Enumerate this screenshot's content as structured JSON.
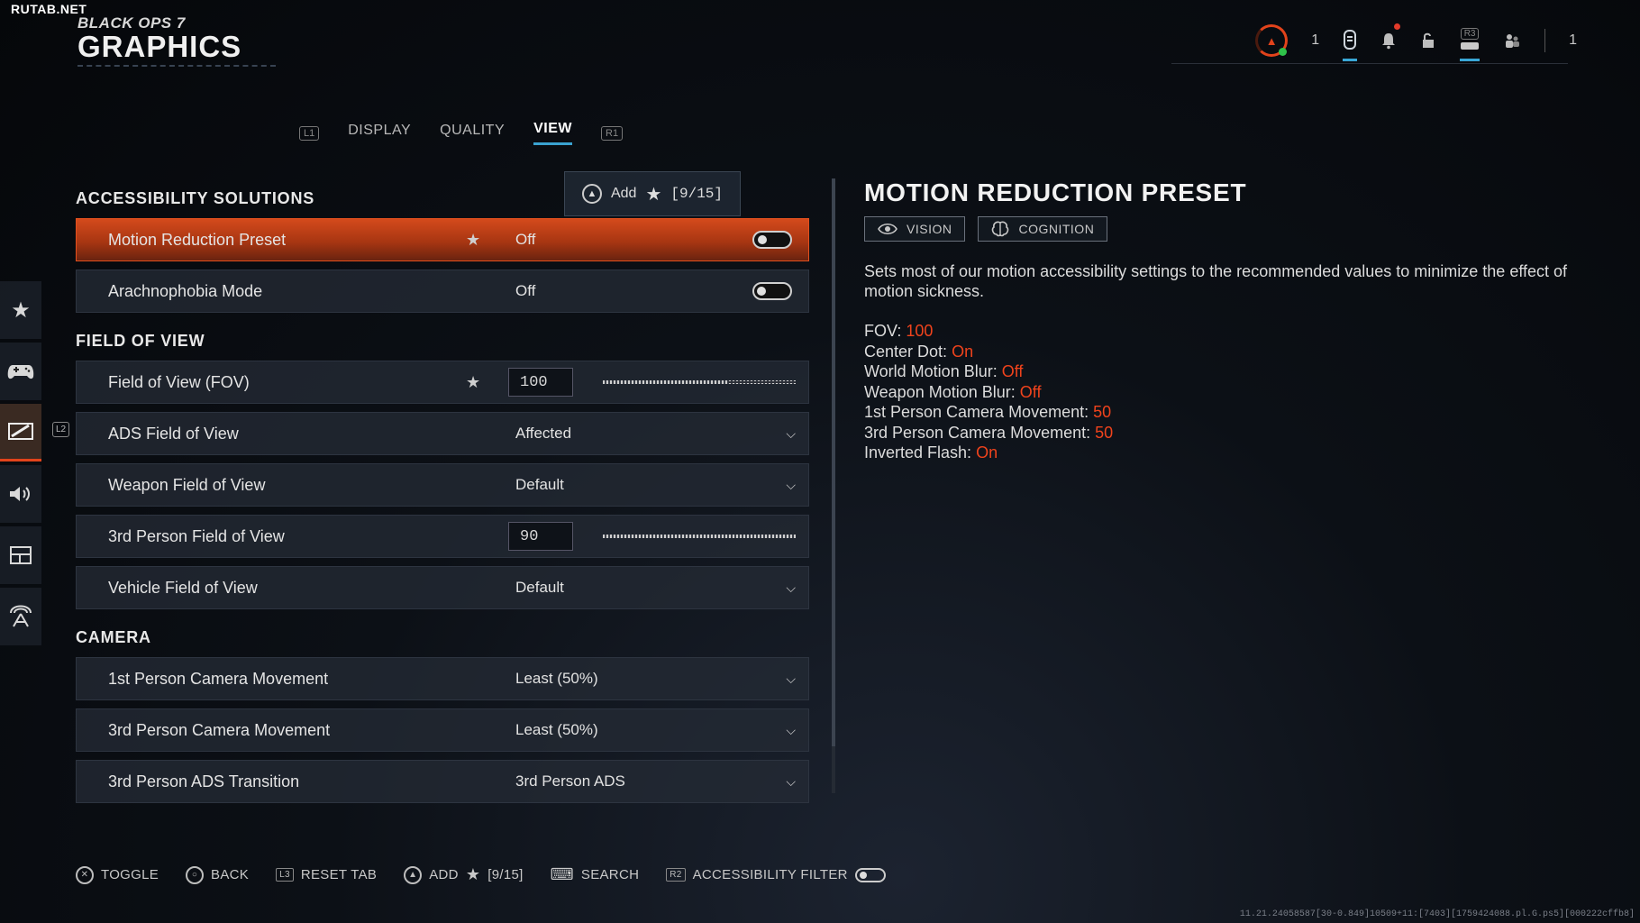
{
  "watermark": "RUTAB.NET",
  "brand": {
    "game": "BLACK OPS 7",
    "title": "GRAPHICS"
  },
  "topbar": {
    "rank_level": "1",
    "rank_glyph": "▲",
    "controller_badge": "R3",
    "party_count": "1"
  },
  "tabs": {
    "left_bumper": "L1",
    "right_bumper": "R1",
    "items": [
      "DISPLAY",
      "QUALITY",
      "VIEW"
    ],
    "active": "VIEW"
  },
  "sidebar": {
    "trigger": "L2",
    "items": [
      "favorites",
      "controller",
      "graphics",
      "audio",
      "interface",
      "network"
    ]
  },
  "add_popup": {
    "label": "Add",
    "count": "[9/15]"
  },
  "sections": {
    "accessibility": {
      "title": "ACCESSIBILITY SOLUTIONS",
      "rows": [
        {
          "label": "Motion Reduction Preset",
          "value": "Off",
          "favorite": true,
          "toggle": false
        },
        {
          "label": "Arachnophobia Mode",
          "value": "Off",
          "favorite": false,
          "toggle": false
        }
      ]
    },
    "fov": {
      "title": "FIELD OF VIEW",
      "rows": [
        {
          "label": "Field of View (FOV)",
          "value": "100",
          "slider_fraction": 0.65
        },
        {
          "label": "ADS Field of View",
          "value": "Affected"
        },
        {
          "label": "Weapon Field of View",
          "value": "Default"
        },
        {
          "label": "3rd Person Field of View",
          "value": "90",
          "slider_fraction": 1.0
        },
        {
          "label": "Vehicle Field of View",
          "value": "Default"
        }
      ]
    },
    "camera": {
      "title": "CAMERA",
      "rows": [
        {
          "label": "1st Person Camera Movement",
          "value": "Least (50%)"
        },
        {
          "label": "3rd Person Camera Movement",
          "value": "Least (50%)"
        },
        {
          "label": "3rd Person ADS Transition",
          "value": "3rd Person ADS"
        }
      ]
    }
  },
  "details": {
    "title": "MOTION REDUCTION PRESET",
    "tags": [
      "VISION",
      "COGNITION"
    ],
    "description": "Sets most of our motion accessibility settings to the recommended values to minimize the effect of motion sickness.",
    "stats": [
      {
        "k": "FOV:",
        "v": "100"
      },
      {
        "k": "Center Dot:",
        "v": "On"
      },
      {
        "k": "World Motion Blur:",
        "v": "Off"
      },
      {
        "k": "Weapon Motion Blur:",
        "v": "Off"
      },
      {
        "k": "1st Person Camera Movement:",
        "v": "50"
      },
      {
        "k": "3rd Person Camera Movement:",
        "v": "50"
      },
      {
        "k": "Inverted Flash:",
        "v": "On"
      }
    ]
  },
  "footer": {
    "toggle": "TOGGLE",
    "back": "BACK",
    "reset_glyph": "L3",
    "reset": "RESET TAB",
    "add": "ADD",
    "add_count": "[9/15]",
    "search": "SEARCH",
    "filter_glyph": "R2",
    "filter": "ACCESSIBILITY FILTER"
  },
  "build": "11.21.24058587[30-0.849]10509+11:[7403][1759424088.pl.G.ps5][000222cffb8]",
  "colors": {
    "accent": "#e2431b",
    "tab_underline": "#3aa2d0",
    "highlight_value": "#f0431c"
  }
}
